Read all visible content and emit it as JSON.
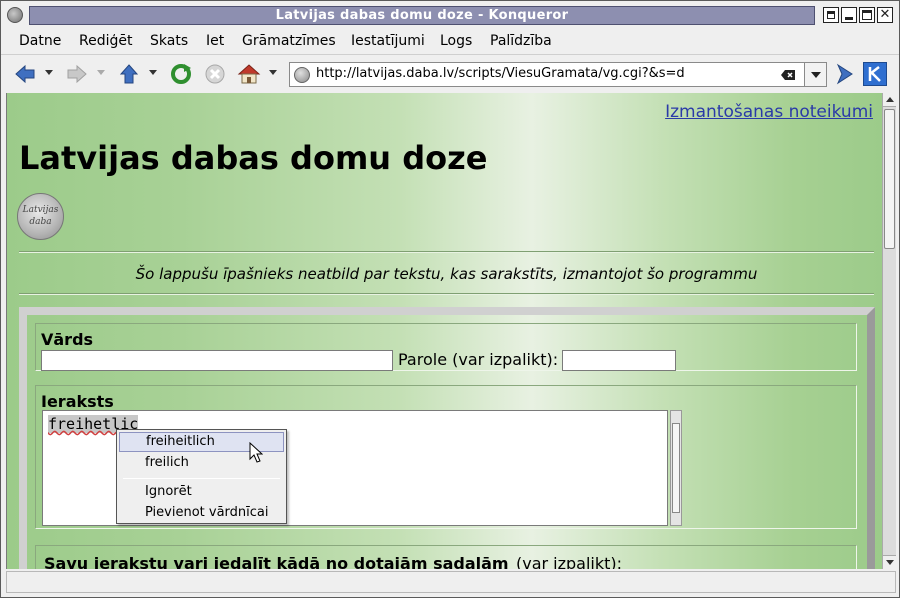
{
  "window": {
    "title": "Latvijas dabas domu doze - Konqueror",
    "close_glyph": "✕"
  },
  "menubar": {
    "items": [
      {
        "label": "Datne"
      },
      {
        "label": "Rediģēt"
      },
      {
        "label": "Skats"
      },
      {
        "label": "Iet"
      },
      {
        "label": "Grāmatzīmes"
      },
      {
        "label": "Iestatījumi"
      },
      {
        "label": "Logs"
      },
      {
        "label": "Palīdzība"
      }
    ]
  },
  "toolbar": {
    "icons": [
      "back-icon",
      "forward-icon",
      "up-icon",
      "reload-icon",
      "stop-icon",
      "home-icon"
    ],
    "url": "http://latvijas.daba.lv/scripts/ViesuGramata/vg.cgi?&s=d"
  },
  "page": {
    "terms_link": "Izmantošanas noteikumi",
    "title": "Latvijas dabas domu doze",
    "logo_text": "Latvijas daba",
    "disclaimer": "Šo lappušu īpašnieks neatbild par tekstu, kas sarakstīts, izmantojot šo programmu",
    "form": {
      "name_label": "Vārds",
      "name_value": "",
      "password_label": "Parole (var izpalikt):",
      "password_value": "",
      "entry_label": "Ieraksts",
      "entry_text": "freihetlic",
      "section_label": "Savu ierakstu vari iedalīt kādā no dotajām sadaļām",
      "section_hint": "(var izpalikt):"
    }
  },
  "context_menu": {
    "suggestions": [
      "freiheitlich",
      "freilich"
    ],
    "actions": [
      "Ignorēt",
      "Pievienot vārdnīcai"
    ]
  },
  "colors": {
    "title_bar": "#8d8fb0",
    "link": "#2a3aa8",
    "page_green": "#9ccb8a"
  }
}
